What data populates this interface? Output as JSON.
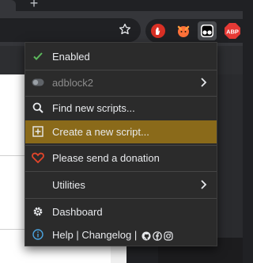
{
  "browser": {
    "new_tab_label": "+",
    "extensions": [
      {
        "icon": "hand-stop-icon",
        "color": "#d93025"
      },
      {
        "icon": "fox-icon",
        "color": "#ff7139"
      },
      {
        "icon": "tampermonkey-icon",
        "color": "#ffffff"
      },
      {
        "icon": "abp-icon",
        "label": "ABP",
        "color": "#e53935"
      }
    ]
  },
  "menu": {
    "enabled_label": "Enabled",
    "script_name": "adblock2",
    "find_scripts_label": "Find new scripts...",
    "create_script_label": "Create a new script...",
    "donation_label": "Please send a donation",
    "utilities_label": "Utilities",
    "dashboard_label": "Dashboard",
    "help_label": "Help | Changelog |"
  },
  "colors": {
    "accent_highlight": "#8a6a1a",
    "enabled_check": "#5cb85c",
    "donation_heart": "#e2452b",
    "help_info": "#4aa3df"
  }
}
